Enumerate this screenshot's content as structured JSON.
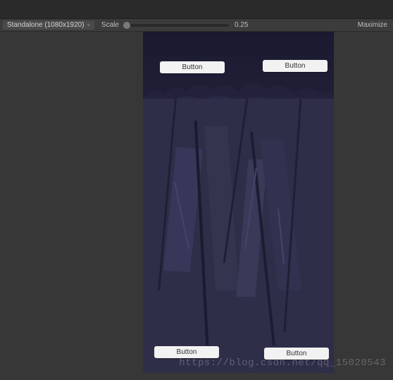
{
  "toolbar": {
    "resolution_label": "Standalone (1080x1920)",
    "scale_label": "Scale",
    "scale_value": "0.25",
    "maximize_label": "Maximize"
  },
  "game": {
    "buttons": {
      "top_left": "Button",
      "top_right": "Button",
      "bottom_left": "Button",
      "bottom_right": "Button"
    }
  },
  "watermark": "https://blog.csdn.net/qq_15020543"
}
